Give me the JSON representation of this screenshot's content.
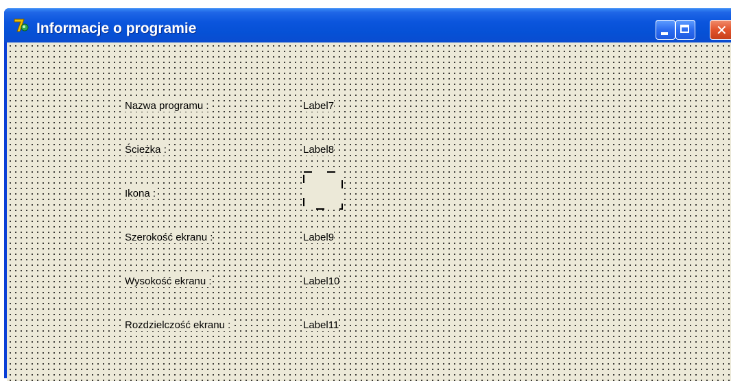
{
  "window": {
    "title": "Informacje o programie"
  },
  "titlebar_buttons": {
    "minimize_icon": "minimize-icon",
    "maximize_icon": "maximize-icon",
    "close_icon": "close-icon",
    "close_glyph": "✕"
  },
  "form": {
    "rows": [
      {
        "caption": "Nazwa programu :",
        "value": "Label7"
      },
      {
        "caption": "Ścieżka :",
        "value": "Label8"
      },
      {
        "caption": "Ikona :",
        "value": null
      },
      {
        "caption": "Szerokość ekranu :",
        "value": "Label9"
      },
      {
        "caption": "Wysokość ekranu :",
        "value": "Label10"
      },
      {
        "caption": "Rozdzielczość ekranu :",
        "value": "Label11"
      }
    ]
  },
  "colors": {
    "titlebar": "#0a55dd",
    "form_background": "#ece9d8",
    "close_button": "#e2542c"
  }
}
